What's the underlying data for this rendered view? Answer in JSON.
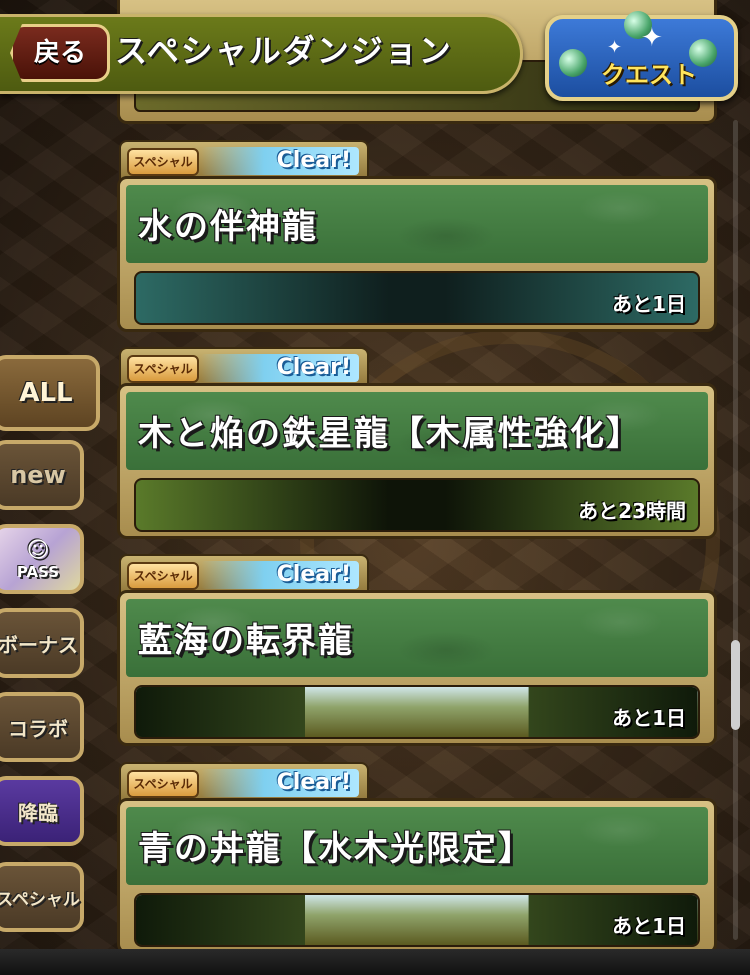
{
  "header": {
    "back_label": "戻る",
    "title": "スペシャルダンジョン",
    "quest_label": "クエスト"
  },
  "side_tabs": [
    {
      "label": "ALL"
    },
    {
      "label": "new"
    },
    {
      "label": "PASS"
    },
    {
      "label": "ボーナス"
    },
    {
      "label": "コラボ"
    },
    {
      "label": "降臨"
    },
    {
      "label": "スペシャル"
    }
  ],
  "dungeons": [
    {
      "tag": "スペシャル",
      "status": "Clear!",
      "title": "水の伴神龍",
      "timer": "あと1日"
    },
    {
      "tag": "スペシャル",
      "status": "Clear!",
      "title": "木と焔の鉄星龍【木属性強化】",
      "timer": "あと23時間"
    },
    {
      "tag": "スペシャル",
      "status": "Clear!",
      "title": "藍海の転界龍",
      "timer": "あと1日"
    },
    {
      "tag": "スペシャル",
      "status": "Clear!",
      "title": "青の丼龍【水木光限定】",
      "timer": "あと1日"
    }
  ]
}
